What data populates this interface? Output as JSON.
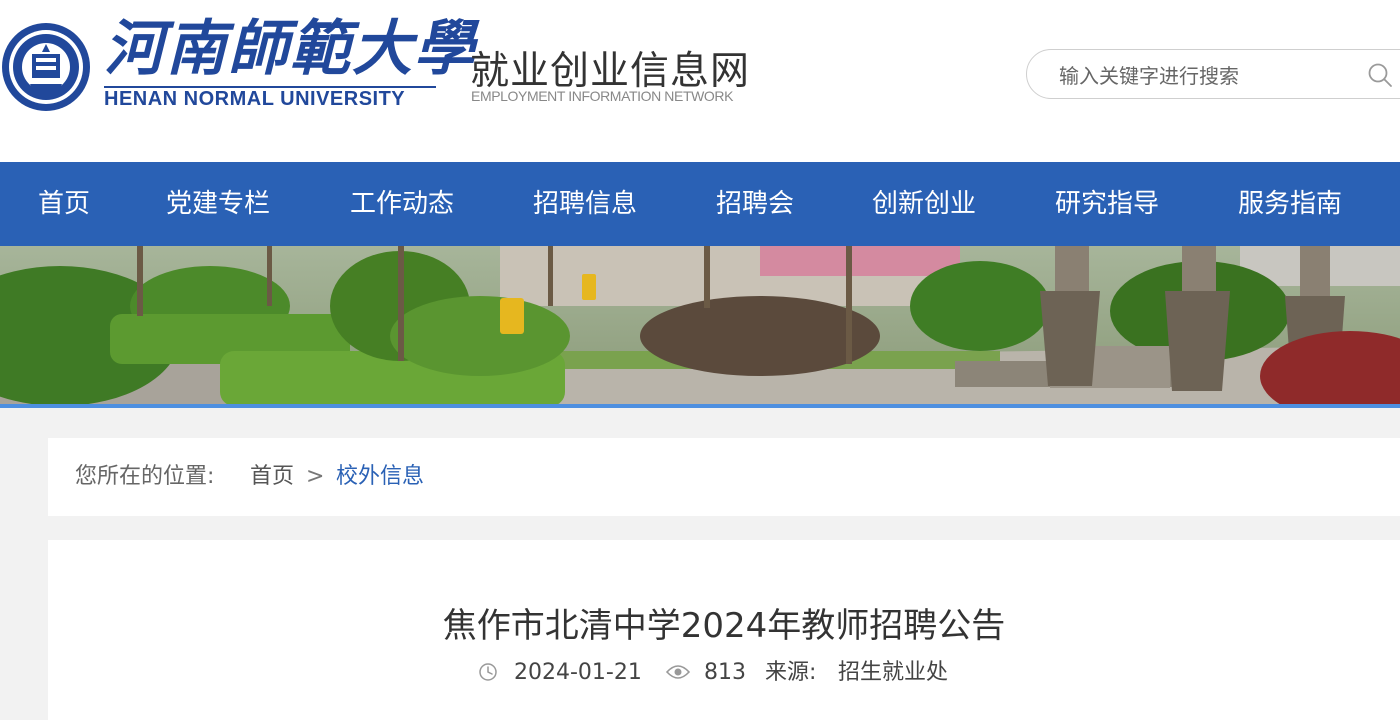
{
  "header": {
    "university_cn": "河南師範大學",
    "university_en": "HENAN NORMAL UNIVERSITY",
    "site_title": "就业创业信息网",
    "site_subtitle": "EMPLOYMENT INFORMATION NETWORK"
  },
  "search": {
    "placeholder": "输入关键字进行搜索",
    "icon": "search-icon"
  },
  "nav": {
    "items": [
      {
        "label": "首页"
      },
      {
        "label": "党建专栏"
      },
      {
        "label": "工作动态"
      },
      {
        "label": "招聘信息"
      },
      {
        "label": "招聘会"
      },
      {
        "label": "创新创业"
      },
      {
        "label": "研究指导"
      },
      {
        "label": "服务指南"
      }
    ]
  },
  "breadcrumb": {
    "prefix": "您所在的位置:",
    "home": "首页",
    "separator": ">",
    "current": "校外信息"
  },
  "article": {
    "title": "焦作市北清中学2024年教师招聘公告",
    "date": "2024-01-21",
    "views": "813",
    "source_label": "来源:",
    "source": "招生就业处",
    "date_icon": "clock-icon",
    "views_icon": "eye-icon"
  },
  "colors": {
    "nav_bg": "#2a61b5",
    "brand_blue": "#21489b",
    "link_blue": "#2a61b5",
    "banner_rule": "#4d8fe0"
  }
}
